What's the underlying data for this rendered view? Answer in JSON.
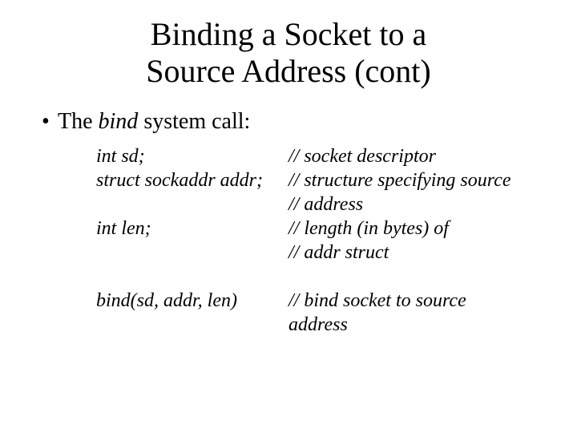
{
  "title_line1": "Binding a Socket to a",
  "title_line2": "Source Address (cont)",
  "bullet_prefix": "The ",
  "bullet_em": "bind",
  "bullet_suffix": " system call:",
  "rows": [
    {
      "left": "int sd;",
      "right": "// socket descriptor"
    },
    {
      "left": "struct sockaddr addr;",
      "right": "// structure specifying source"
    },
    {
      "left": "",
      "right": "// address"
    },
    {
      "left": "int len;",
      "right": "// length (in bytes) of"
    },
    {
      "left": "",
      "right": "// addr struct"
    }
  ],
  "call": {
    "left": "bind(sd, addr, len)",
    "right": "// bind socket to source address"
  }
}
